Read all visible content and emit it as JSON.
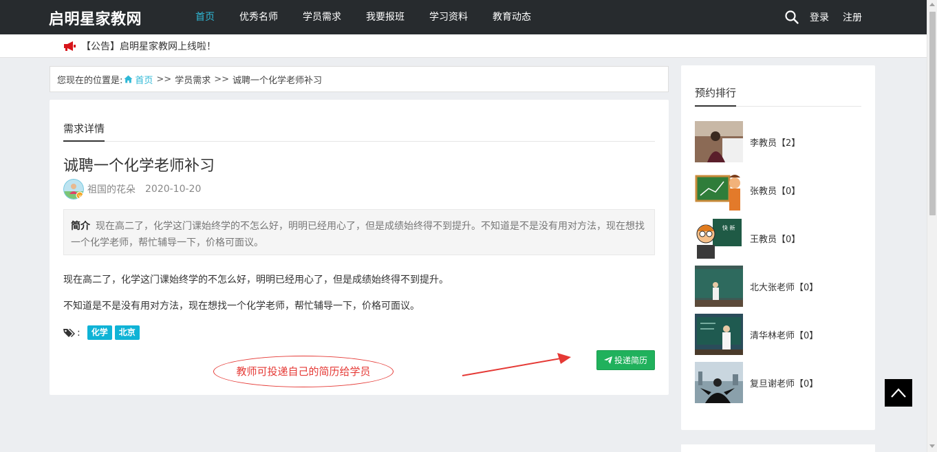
{
  "header": {
    "logo": "启明星家教网",
    "nav": [
      {
        "label": "首页",
        "active": true
      },
      {
        "label": "优秀名师",
        "active": false
      },
      {
        "label": "学员需求",
        "active": false
      },
      {
        "label": "我要报班",
        "active": false
      },
      {
        "label": "学习资料",
        "active": false
      },
      {
        "label": "教育动态",
        "active": false
      }
    ],
    "login": "登录",
    "register": "注册"
  },
  "notice": {
    "text": "【公告】启明星家教网上线啦！"
  },
  "breadcrumb": {
    "prefix": "您现在的位置是:",
    "home": "首页",
    "sep1": ">>",
    "level2": "学员需求",
    "sep2": ">>",
    "current": "诚聘一个化学老师补习"
  },
  "post": {
    "section_title": "需求详情",
    "title": "诚聘一个化学老师补习",
    "author": "祖国的花朵",
    "date": "2020-10-20",
    "summary_label": "简介",
    "summary_text": "现在高二了，化学这门课始终学的不怎么好，明明已经用心了，但是成绩始终得不到提升。不知道是不是没有用对方法，现在想找一个化学老师，帮忙辅导一下，价格可面议。",
    "paragraphs": [
      "现在高二了，化学这门课始终学的不怎么好，明明已经用心了，但是成绩始终得不到提升。",
      "不知道是不是没有用对方法，现在想找一个化学老师，帮忙辅导一下，价格可面议。"
    ],
    "tags_colon": ":",
    "tags": [
      "化学",
      "北京"
    ],
    "resume_button": "投递简历",
    "annotation": "教师可投递自己的简历给学员"
  },
  "sidebar": {
    "title": "预约排行",
    "items": [
      {
        "name": "李教员【2】"
      },
      {
        "name": "张教员【0】"
      },
      {
        "name": "王教员【0】"
      },
      {
        "name": "北大张老师【0】"
      },
      {
        "name": "清华林老师【0】"
      },
      {
        "name": "复旦谢老师【0】"
      }
    ]
  },
  "colors": {
    "topbar": "#272b2e",
    "accent": "#2fb8d6",
    "tag": "#0fb3d6",
    "button": "#20b15c",
    "annotation": "#e53935"
  },
  "icons": {
    "search": "search-icon",
    "notice": "megaphone-icon",
    "home": "home-icon",
    "tags": "tags-icon",
    "send": "paper-plane-icon",
    "back_top": "chevron-up-icon"
  }
}
